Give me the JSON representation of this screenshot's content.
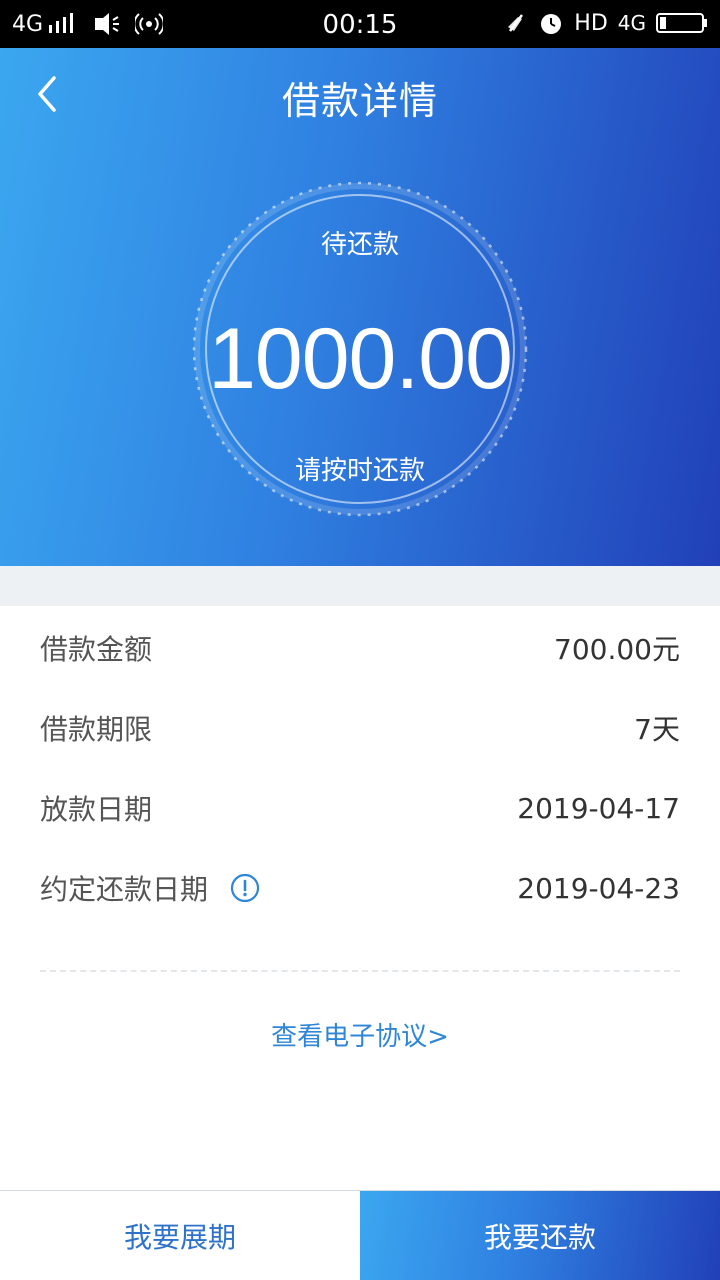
{
  "status_bar": {
    "network": "4G",
    "time": "00:15",
    "hd": "HD",
    "network_right": "4G",
    "icons": [
      "signal-icon",
      "vibrate-icon",
      "hotspot-icon",
      "muted-icon",
      "alarm-icon",
      "battery-icon"
    ]
  },
  "header": {
    "title": "借款详情",
    "back_icon": "chevron-left-icon"
  },
  "summary": {
    "label": "待还款",
    "amount": "1000.00",
    "note": "请按时还款"
  },
  "details": {
    "rows": [
      {
        "label": "借款金额",
        "value": "700.00元"
      },
      {
        "label": "借款期限",
        "value": "7天"
      },
      {
        "label": "放款日期",
        "value": "2019-04-17"
      },
      {
        "label": "约定还款日期",
        "value": "2019-04-23"
      }
    ],
    "info_icon": "info-icon"
  },
  "agreement_link": "查看电子协议>",
  "actions": {
    "extend": "我要展期",
    "repay": "我要还款"
  },
  "colors": {
    "gradient_start": "#3ba7f0",
    "gradient_end": "#2140b8",
    "link": "#2f86d6"
  }
}
